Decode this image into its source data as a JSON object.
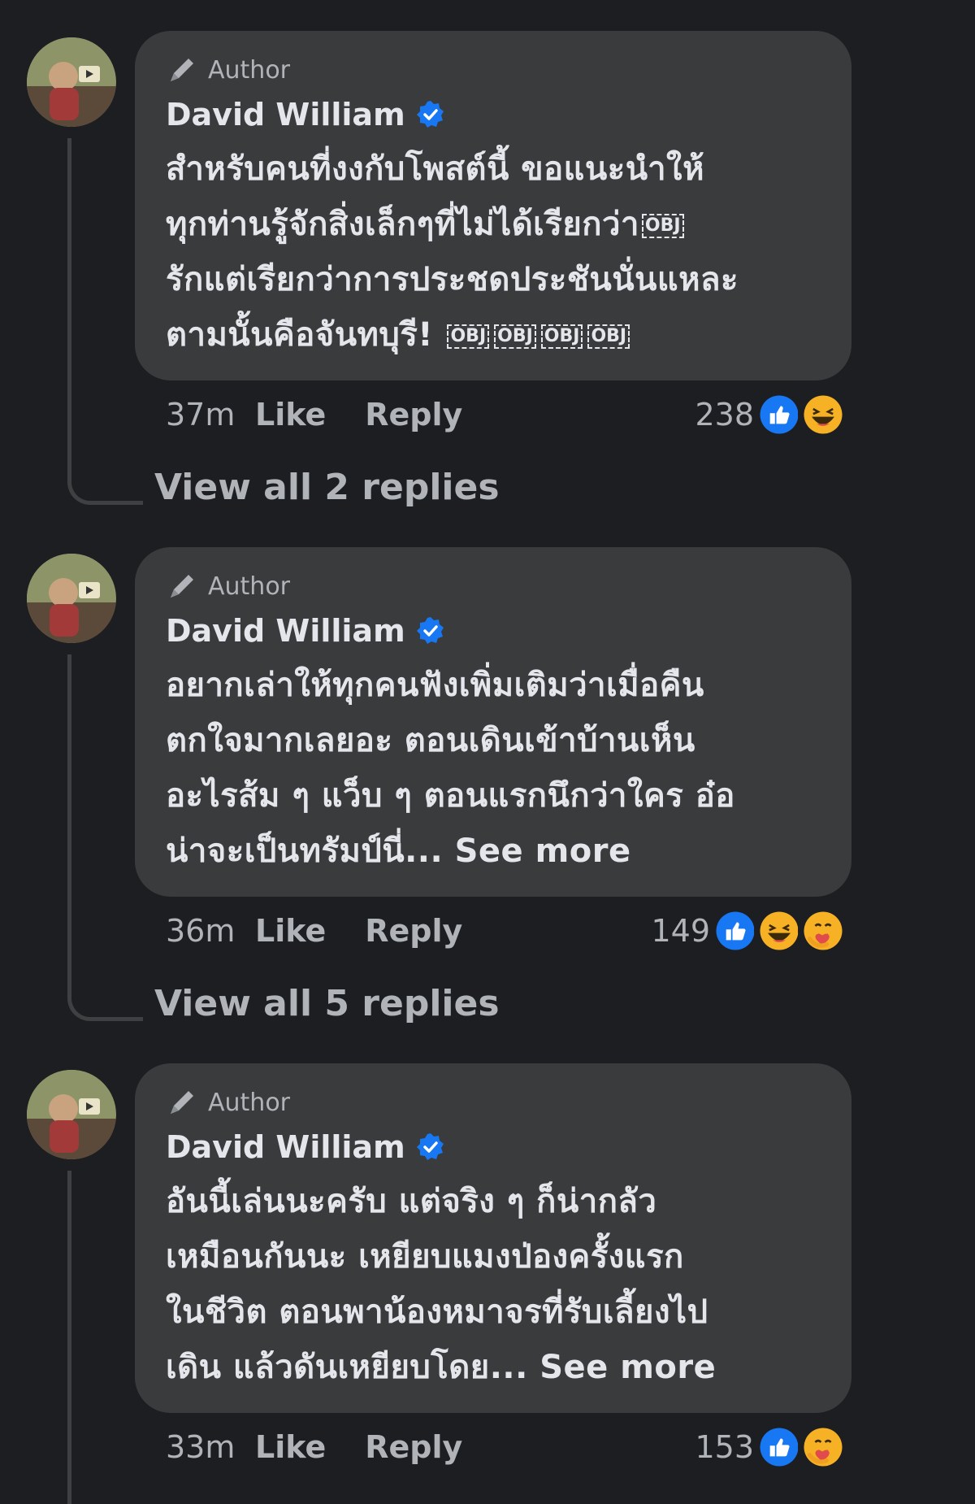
{
  "comments": [
    {
      "badge": "Author",
      "name": "David William",
      "text_lines": [
        "สำหรับคนที่งงกับโพสต์นี้ ขอแนะนำให้",
        "ทุกท่านรู้จักสิ่งเล็กๆที่ไม่ได้เรียกว่า",
        "รักแต่เรียกว่าการประชดประชันนั่นแหละ",
        "ตามนั้นคือจันทบุรี!"
      ],
      "obj_marker": "OBJ",
      "time": "37m",
      "like_label": "Like",
      "reply_label": "Reply",
      "reaction_count": "238",
      "reactions": [
        "like-icon",
        "haha-icon"
      ],
      "view_replies": "View all 2 replies"
    },
    {
      "badge": "Author",
      "name": "David William",
      "text_lines": [
        "อยากเล่าให้ทุกคนฟังเพิ่มเติมว่าเมื่อคืน",
        "ตกใจมากเลยอะ ตอนเดินเข้าบ้านเห็น",
        "อะไรส้ม ๆ แว็บ ๆ ตอนแรกนึกว่าใคร อ๋อ",
        "น่าจะเป็นทรัมป์นี่..."
      ],
      "see_more": "See more",
      "time": "36m",
      "like_label": "Like",
      "reply_label": "Reply",
      "reaction_count": "149",
      "reactions": [
        "like-icon",
        "haha-icon",
        "care-icon"
      ],
      "view_replies": "View all 5 replies"
    },
    {
      "badge": "Author",
      "name": "David William",
      "text_lines": [
        "อันนี้เล่นนะครับ แต่จริง ๆ ก็น่ากลัว",
        "เหมือนกันนะ เหยียบแมงป่องครั้งแรก",
        "ในชีวิต ตอนพาน้องหมาจรที่รับเลี้ยงไป",
        "เดิน แล้วดันเหยียบโดย..."
      ],
      "see_more": "See more",
      "time": "33m",
      "like_label": "Like",
      "reply_label": "Reply",
      "reaction_count": "153",
      "reactions": [
        "like-icon",
        "care-icon"
      ]
    }
  ],
  "colors": {
    "background": "#1c1e21",
    "bubble": "#3a3b3c",
    "text": "#e4e6eb",
    "secondary_text": "#b0b3b8",
    "verified_blue": "#1877f2"
  }
}
